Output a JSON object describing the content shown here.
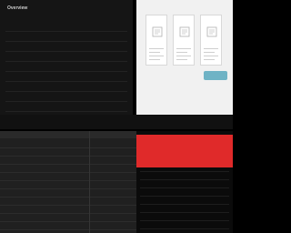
{
  "colors": {
    "dark_panel": "#151515",
    "light_panel": "#f1f1f1",
    "accent_button": "#6fb3c5",
    "alert_red": "#e02a2a",
    "table_bg": "#202020"
  },
  "top_left": {
    "title": "Overview",
    "subtitle": "",
    "rows": [
      {
        "label": "",
        "value": ""
      },
      {
        "label": "",
        "value": ""
      },
      {
        "label": "",
        "value": ""
      },
      {
        "label": "",
        "value": ""
      },
      {
        "label": "",
        "value": ""
      },
      {
        "label": "",
        "value": ""
      },
      {
        "label": "",
        "value": ""
      },
      {
        "label": "",
        "value": ""
      },
      {
        "label": "",
        "value": ""
      }
    ]
  },
  "top_right": {
    "header": "",
    "cards": [
      {
        "title": "",
        "icon": "document-icon",
        "value": ""
      },
      {
        "title": "",
        "icon": "document-icon",
        "value": ""
      },
      {
        "title": "",
        "icon": "document-icon",
        "value": ""
      }
    ],
    "button_label": ""
  },
  "divider": {
    "tabs": [
      "",
      "",
      ""
    ]
  },
  "bottom_left": {
    "columns": [
      "",
      "",
      ""
    ],
    "rows": [
      [
        "",
        "",
        ""
      ],
      [
        "",
        "",
        ""
      ],
      [
        "",
        "",
        ""
      ],
      [
        "",
        "",
        ""
      ],
      [
        "",
        "",
        ""
      ],
      [
        "",
        "",
        ""
      ],
      [
        "",
        "",
        ""
      ],
      [
        "",
        "",
        ""
      ],
      [
        "",
        "",
        ""
      ],
      [
        "",
        "",
        ""
      ],
      [
        "",
        "",
        ""
      ]
    ]
  },
  "bottom_right": {
    "banner_title": "",
    "banner_subtitle": "",
    "rows": [
      [
        "",
        "",
        ""
      ],
      [
        "",
        "",
        ""
      ],
      [
        "",
        "",
        ""
      ],
      [
        "",
        "",
        ""
      ],
      [
        "",
        "",
        ""
      ],
      [
        "",
        "",
        ""
      ],
      [
        "",
        "",
        ""
      ],
      [
        "",
        "",
        ""
      ]
    ]
  }
}
